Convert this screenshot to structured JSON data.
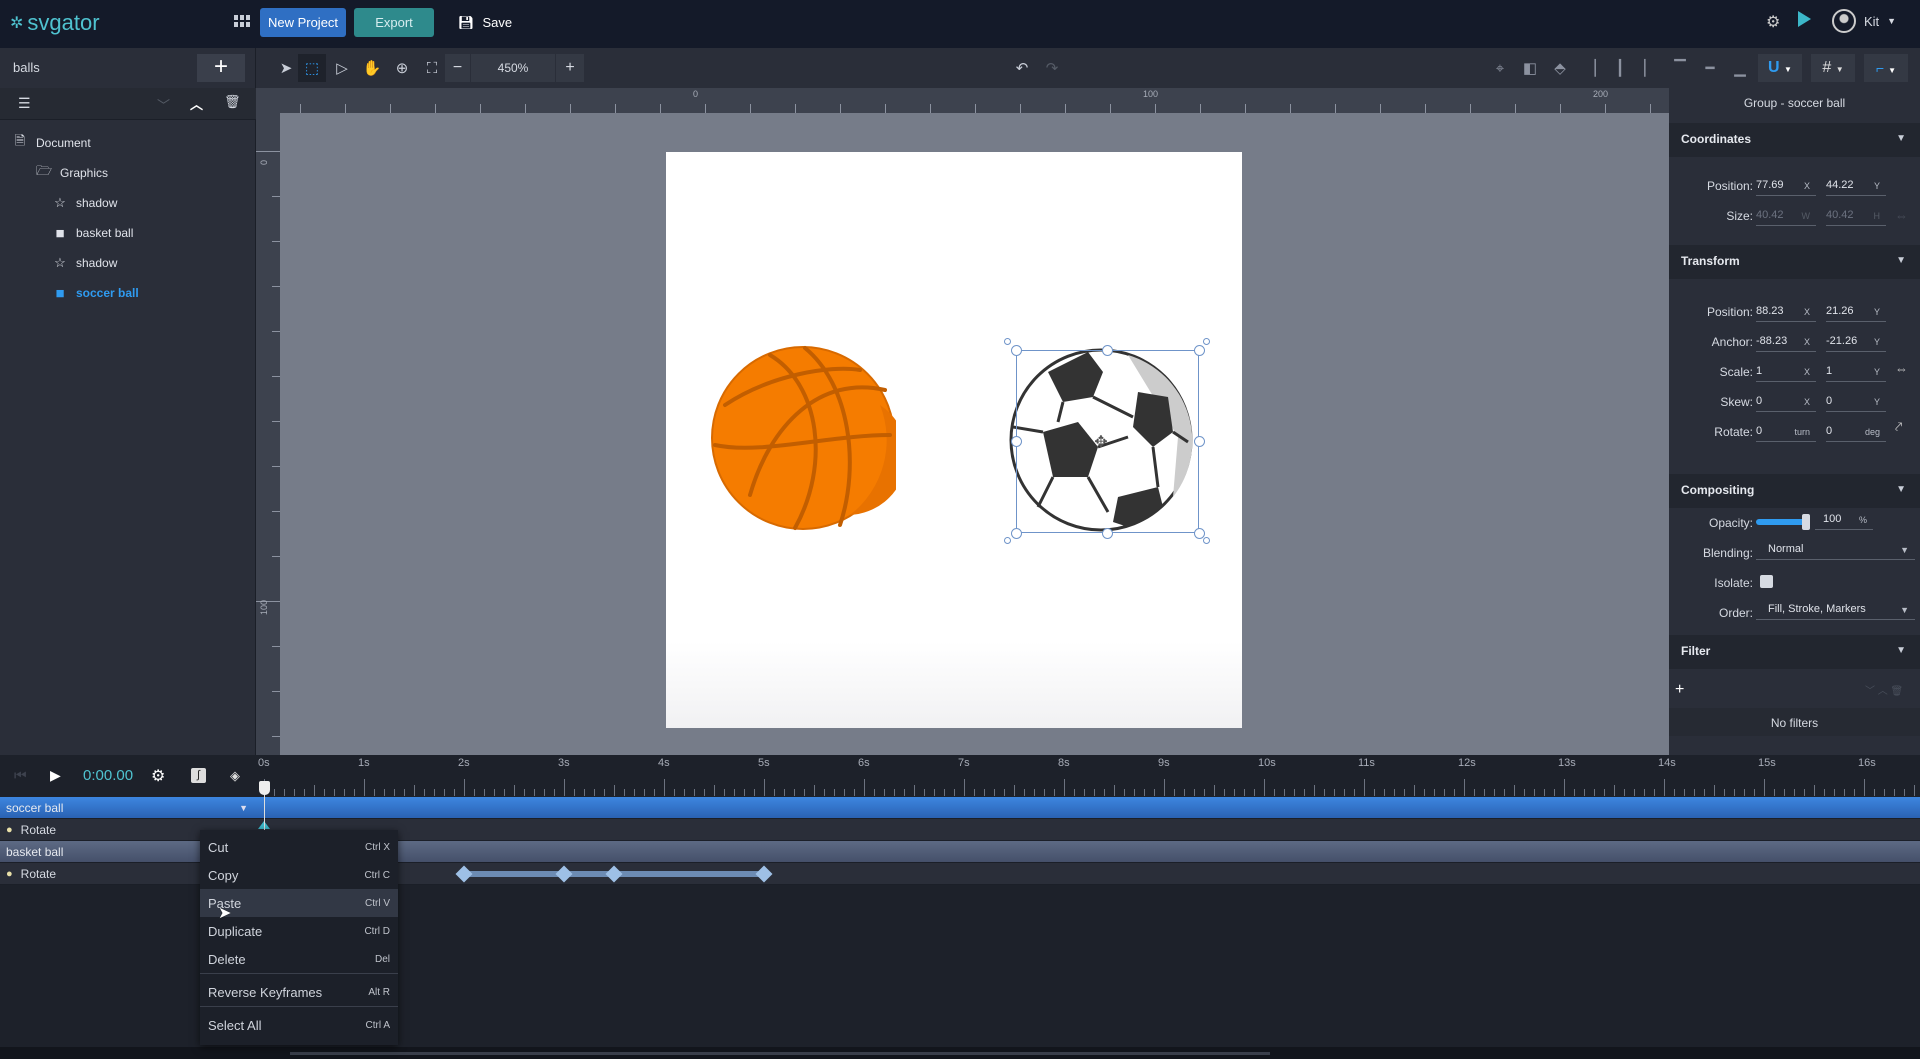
{
  "app": {
    "logo": "svgator",
    "new_project": "New Project",
    "export": "Export",
    "save": "Save",
    "user": "Kit"
  },
  "colors": {
    "accent": "#2f9bf0",
    "new_project_bg": "#2f6fc3",
    "export_bg": "#2e8a8c",
    "basketball": "#f57c00",
    "selection": "#6f94c9",
    "timeline_bar": "#2f6fc3"
  },
  "project": {
    "name": "balls"
  },
  "toolbar": {
    "zoom": "450%"
  },
  "layers": [
    {
      "label": "Document",
      "icon": "document-icon",
      "level": 0
    },
    {
      "label": "Graphics",
      "icon": "folder-open-icon",
      "level": 1
    },
    {
      "label": "shadow",
      "icon": "star-icon",
      "level": 2
    },
    {
      "label": "basket ball",
      "icon": "folder-icon",
      "level": 2
    },
    {
      "label": "shadow",
      "icon": "star-icon",
      "level": 2
    },
    {
      "label": "soccer ball",
      "icon": "folder-icon",
      "level": 2,
      "selected": true
    }
  ],
  "ruler": {
    "h": [
      "0",
      "100",
      "200"
    ],
    "v": [
      "0",
      "100"
    ]
  },
  "inspector": {
    "title": "Group - soccer ball",
    "coordinates": {
      "title": "Coordinates",
      "position_label": "Position:",
      "pos_x": "77.69",
      "pos_y": "44.22",
      "size_label": "Size:",
      "w": "40.42",
      "h": "40.42"
    },
    "transform": {
      "title": "Transform",
      "position_label": "Position:",
      "pos_x": "88.23",
      "pos_y": "21.26",
      "anchor_label": "Anchor:",
      "anc_x": "-88.23",
      "anc_y": "-21.26",
      "scale_label": "Scale:",
      "scale_x": "1",
      "scale_y": "1",
      "skew_label": "Skew:",
      "skew_x": "0",
      "skew_y": "0",
      "rotate_label": "Rotate:",
      "rot_turn": "0",
      "rot_deg": "0"
    },
    "units": {
      "x": "X",
      "y": "Y",
      "w": "W",
      "h": "H",
      "turn": "turn",
      "deg": "deg",
      "pct": "%"
    },
    "compositing": {
      "title": "Compositing",
      "opacity_label": "Opacity:",
      "opacity": "100",
      "opacity_fraction": 1.0,
      "blending_label": "Blending:",
      "blending": "Normal",
      "isolate_label": "Isolate:",
      "isolate": false,
      "order_label": "Order:",
      "order": "Fill, Stroke, Markers"
    },
    "filter": {
      "title": "Filter",
      "empty": "No filters"
    }
  },
  "timeline": {
    "time": "0:00.00",
    "ticks": [
      "0s",
      "1s",
      "2s",
      "3s",
      "4s",
      "5s",
      "6s",
      "7s",
      "8s",
      "9s",
      "10s",
      "11s",
      "12s",
      "13s",
      "14s",
      "15s",
      "16s"
    ],
    "rows": [
      {
        "label": "soccer ball",
        "type": "group",
        "selected": true
      },
      {
        "label": "Rotate",
        "type": "property",
        "keyframes_s": [
          0
        ]
      },
      {
        "label": "basket ball",
        "type": "group"
      },
      {
        "label": "Rotate",
        "type": "property",
        "keyframes_s": [
          2,
          3,
          3.5,
          5
        ]
      }
    ]
  },
  "context_menu": [
    {
      "label": "Cut",
      "shortcut": "Ctrl X"
    },
    {
      "label": "Copy",
      "shortcut": "Ctrl C"
    },
    {
      "label": "Paste",
      "shortcut": "Ctrl V",
      "hover": true
    },
    {
      "label": "Duplicate",
      "shortcut": "Ctrl D"
    },
    {
      "label": "Delete",
      "shortcut": "Del"
    },
    {
      "label": "Reverse Keyframes",
      "shortcut": "Alt R"
    },
    {
      "label": "Select All",
      "shortcut": "Ctrl A"
    }
  ]
}
